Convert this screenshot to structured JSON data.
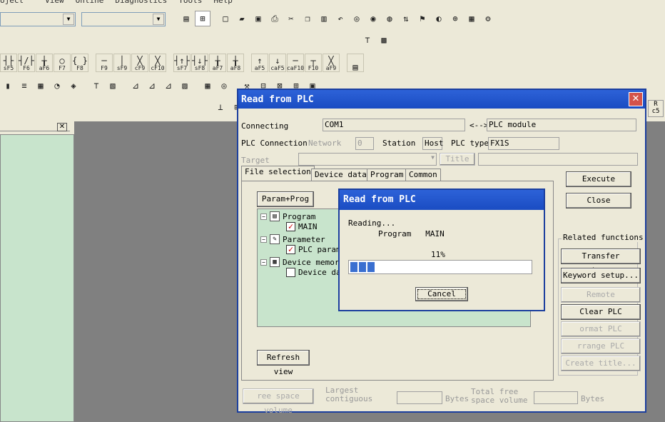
{
  "menu": [
    "oject",
    "View",
    "Online",
    "Diagnostics",
    "Tools",
    "Help"
  ],
  "ladder_keys": [
    "sF5",
    "F6",
    "aF6",
    "F7",
    "F8",
    "F9",
    "sF9",
    "cF9",
    "cF10",
    "sF7",
    "sF8",
    "aF7",
    "aF8",
    "aF5",
    "caF5",
    "caF10",
    "F10",
    "aF9"
  ],
  "right_keys": [
    "R",
    "c5"
  ],
  "dialog": {
    "title": "Read from PLC",
    "connecting_label": "Connecting",
    "connecting_value": "COM1",
    "connecting_arrow": "<-->",
    "connecting_target": "PLC module",
    "plc_connection_label": "PLC Connection",
    "network_label": "Network",
    "network_value": "0",
    "station_label": "Station",
    "station_value": "Host",
    "plc_type_label": "PLC type",
    "plc_type_value": "FX1S",
    "target_label": "Target",
    "title_button": "Title",
    "tabs": [
      "File selection",
      "Device data",
      "Program",
      "Common"
    ],
    "param_prog_button": "Param+Prog",
    "tree": {
      "program": "Program",
      "main": "MAIN",
      "parameter": "Parameter",
      "plc_param": "PLC param",
      "device_memory": "Device memor",
      "device_data": "Device da"
    },
    "refresh_button": "Refresh view",
    "execute_button": "Execute",
    "close_button": "Close",
    "related_functions": "Related functions",
    "transfer_setup": "Transfer setup...",
    "keyword_setup": "Keyword setup...",
    "remote_operation": "Remote operation...",
    "clear_plc_memory": "Clear PLC memory...",
    "format_plc_memory": "ormat PLC memory...",
    "arrange_plc_memory": "rrange PLC memory...",
    "create_title": "Create title...",
    "free_space_button": "ree space volume",
    "largest_contiguous": [
      "Largest",
      "contiguous"
    ],
    "bytes1": "Bytes",
    "total_free": [
      "Total free",
      "space volume"
    ],
    "bytes2": "Bytes"
  },
  "progress": {
    "title": "Read from PLC",
    "status": "Reading...",
    "item": "Program   MAIN",
    "percent_label": "11%",
    "percent_value": 11,
    "cancel_button": "Cancel"
  },
  "colors": {
    "title_bar": "#1a4cc2",
    "tree_bg": "#c8e4cc",
    "workspace": "#808080",
    "progress_fill": "#3a6fd0"
  }
}
